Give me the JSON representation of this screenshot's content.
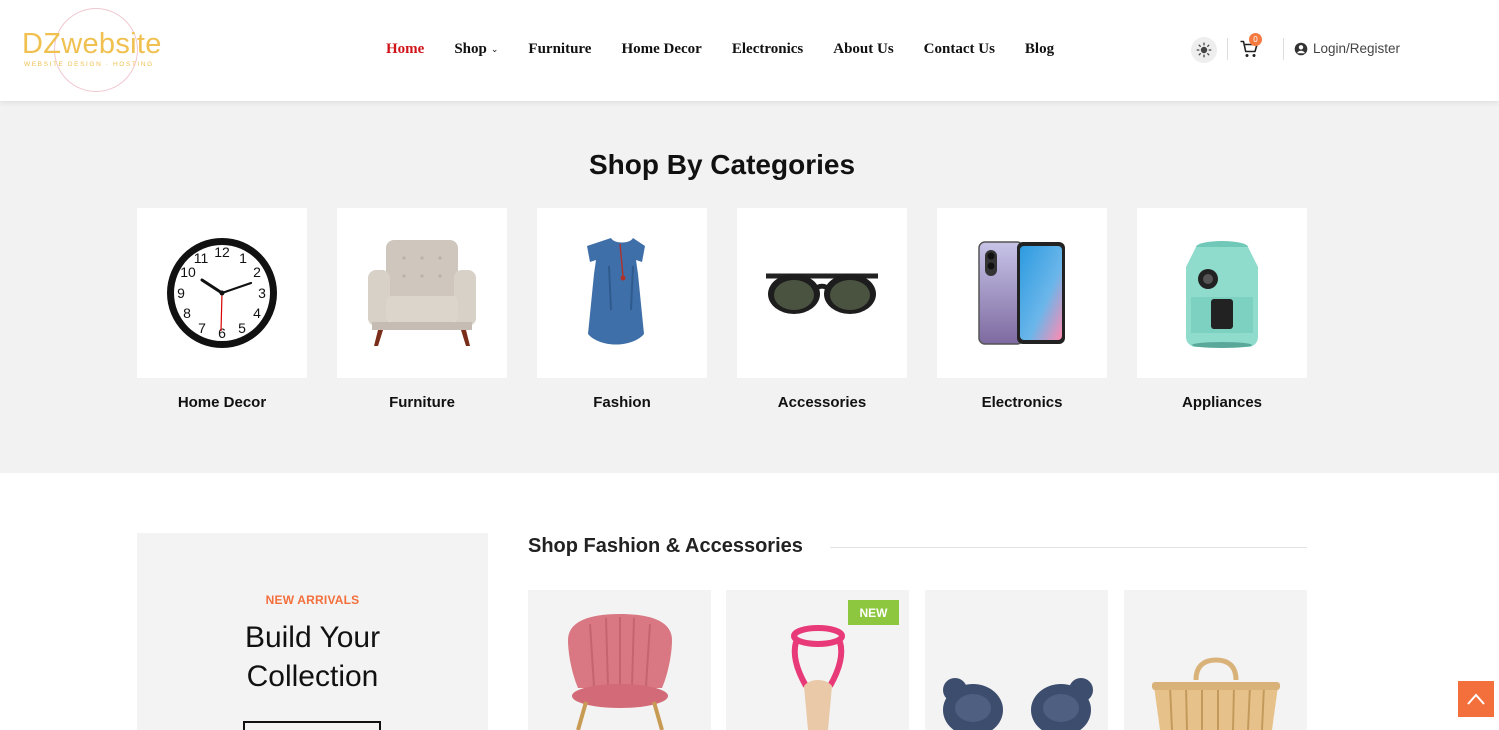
{
  "brand": {
    "name": "DZwebsite",
    "tagline": "WEBSITE DESIGN · HOSTING",
    "color": "#f0c050"
  },
  "nav": {
    "items": [
      {
        "label": "Home",
        "active": true
      },
      {
        "label": "Shop",
        "has_dropdown": true
      },
      {
        "label": "Furniture"
      },
      {
        "label": "Home Decor"
      },
      {
        "label": "Electronics"
      },
      {
        "label": "About Us"
      },
      {
        "label": "Contact Us"
      },
      {
        "label": "Blog"
      }
    ],
    "active_color": "#d0141a"
  },
  "header_actions": {
    "theme_icon": "sun-icon",
    "cart_icon": "cart-icon",
    "cart_count": "0",
    "login_label": "Login/Register",
    "login_icon": "user-circle-icon"
  },
  "categories": {
    "title": "Shop By Categories",
    "items": [
      {
        "label": "Home Decor",
        "icon": "wall-clock"
      },
      {
        "label": "Furniture",
        "icon": "armchair"
      },
      {
        "label": "Fashion",
        "icon": "dress"
      },
      {
        "label": "Accessories",
        "icon": "sunglasses"
      },
      {
        "label": "Electronics",
        "icon": "smartphone"
      },
      {
        "label": "Appliances",
        "icon": "air-fryer"
      }
    ]
  },
  "promo": {
    "eyebrow": "NEW ARRIVALS",
    "title_line1": "Build Your",
    "title_line2": "Collection",
    "accent": "#f36f3c"
  },
  "fashion": {
    "title": "Shop Fashion & Accessories",
    "products": [
      {
        "image": "pink-velvet-chair"
      },
      {
        "image": "pink-heel-sandal",
        "badge": "NEW"
      },
      {
        "image": "navy-earbuds"
      },
      {
        "image": "bamboo-bag"
      }
    ],
    "badge_color": "#8dc63f"
  },
  "scroll_top_icon": "chevron-up-icon"
}
